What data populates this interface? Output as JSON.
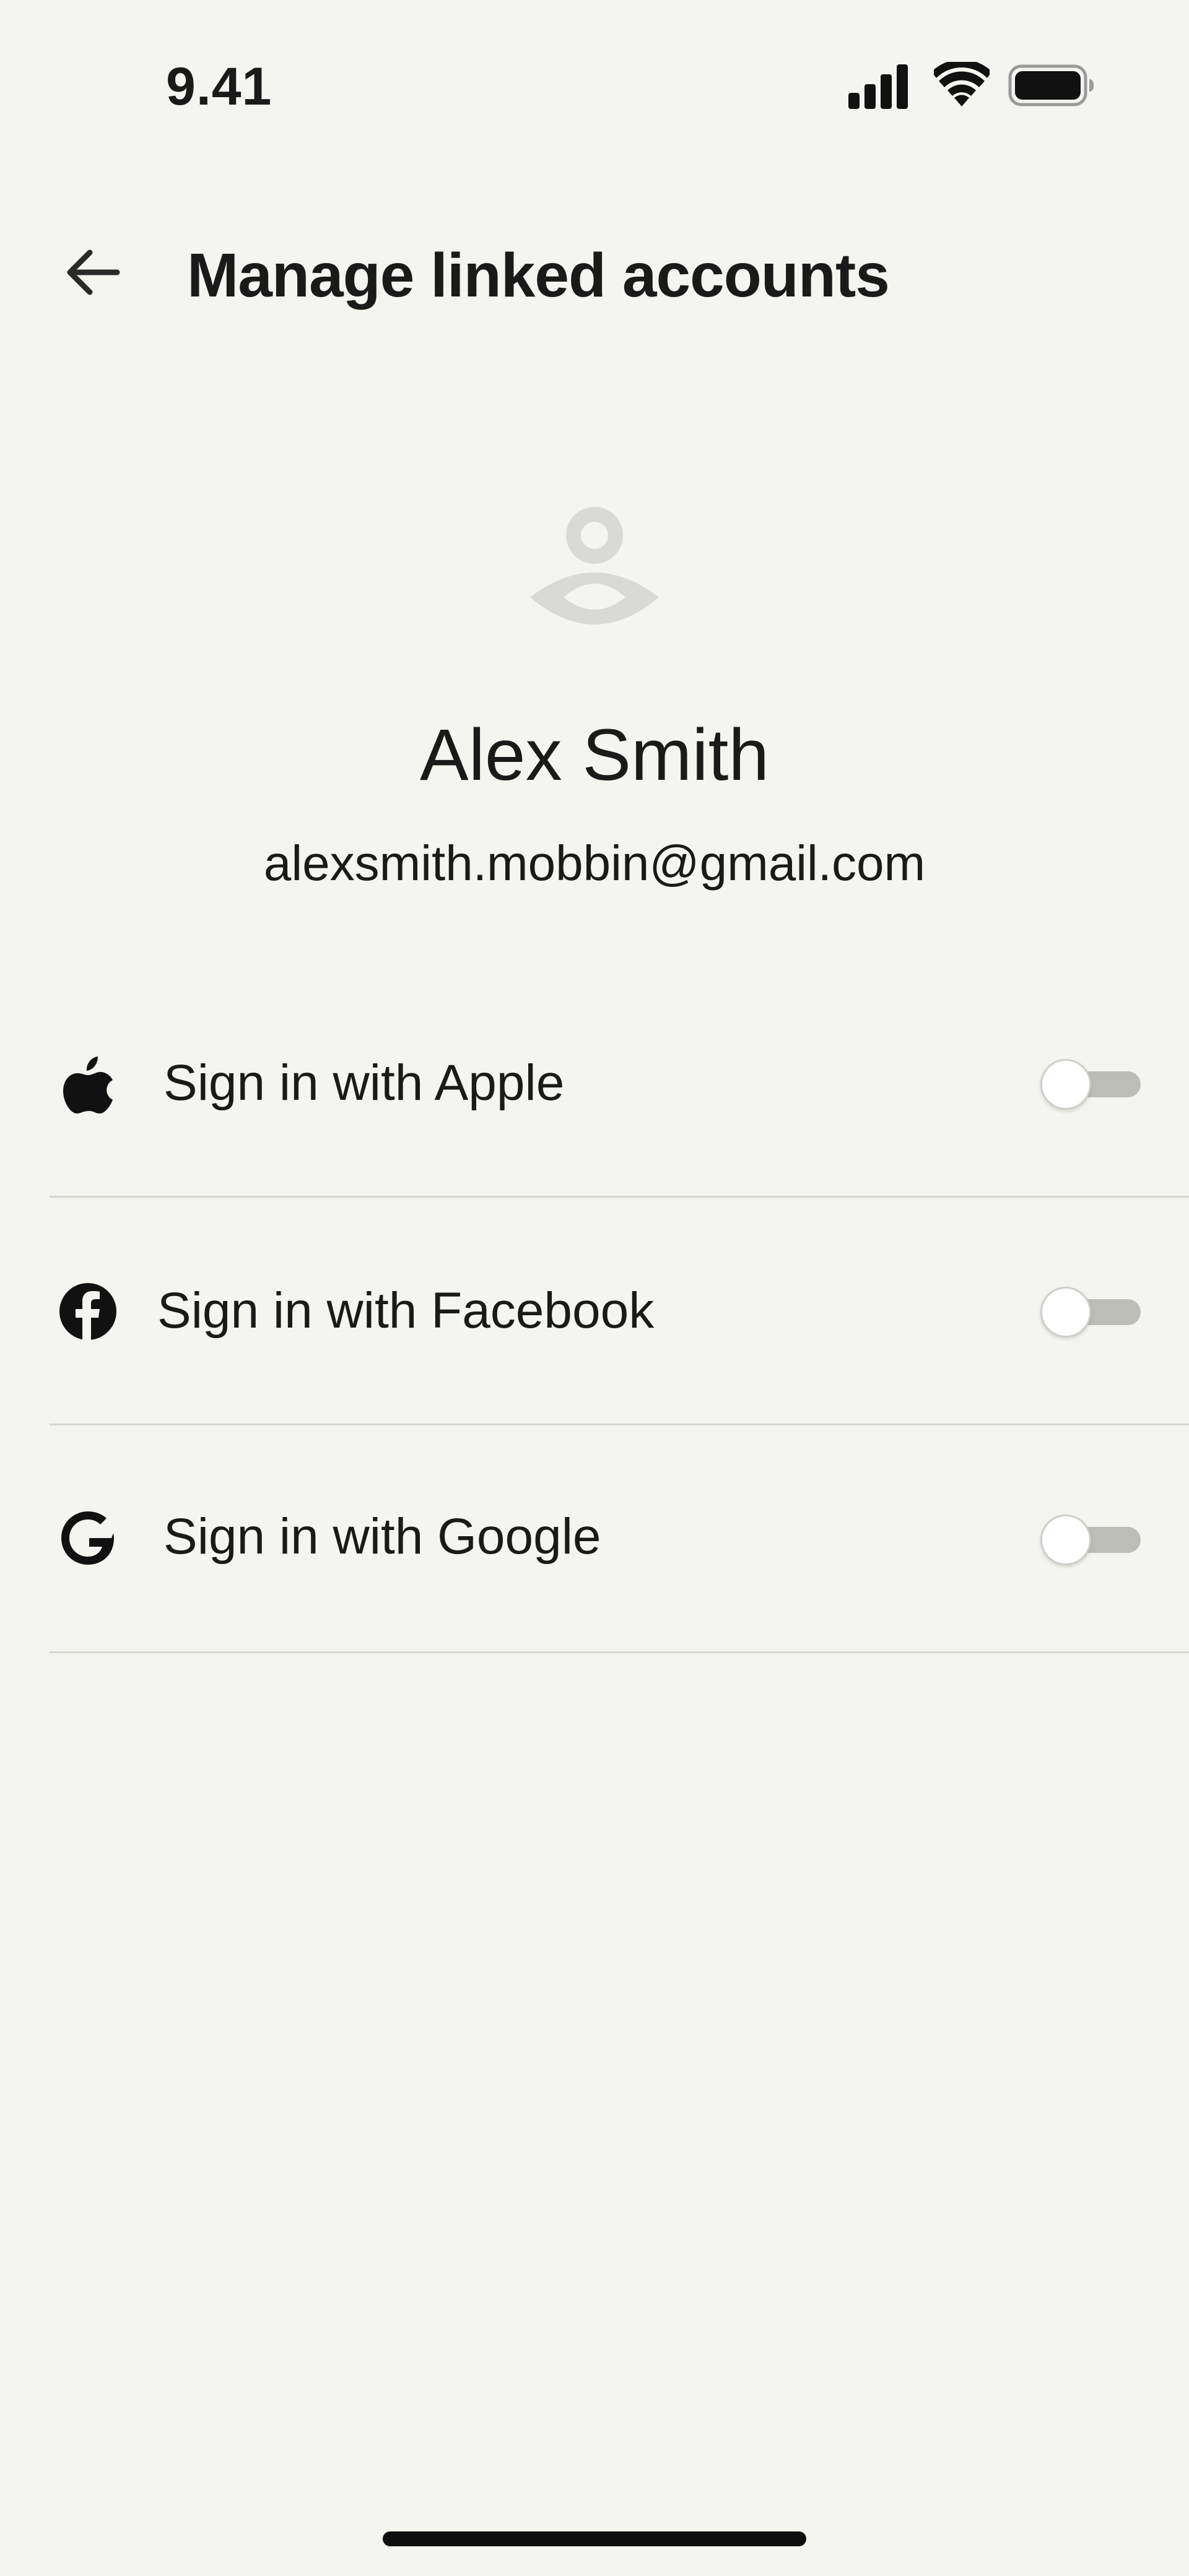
{
  "status_bar": {
    "time": "9.41"
  },
  "header": {
    "title": "Manage linked accounts",
    "back_icon": "arrow-left-icon"
  },
  "profile": {
    "avatar_icon": "user-avatar-icon",
    "name": "Alex Smith",
    "email": "alexsmith.mobbin@gmail.com"
  },
  "accounts": [
    {
      "label": "Sign in with Apple",
      "icon": "apple-icon",
      "enabled": false
    },
    {
      "label": "Sign in with Facebook",
      "icon": "facebook-icon",
      "enabled": false
    },
    {
      "label": "Sign in with Google",
      "icon": "google-icon",
      "enabled": false
    }
  ],
  "colors": {
    "background": "#f4f4f0",
    "text": "#1a1a1a",
    "avatar": "#d9d9d6",
    "toggle_track": "#bdbdb8",
    "divider": "#d8d8d3"
  }
}
